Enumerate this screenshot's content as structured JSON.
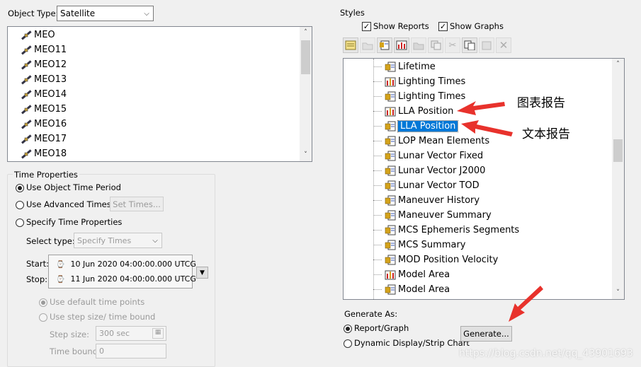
{
  "object_type": {
    "label": "Object Type:",
    "value": "Satellite"
  },
  "objects": [
    "MEO",
    "MEO11",
    "MEO12",
    "MEO13",
    "MEO14",
    "MEO15",
    "MEO16",
    "MEO17",
    "MEO18"
  ],
  "time_props": {
    "title": "Time Properties",
    "use_object": "Use Object Time Period",
    "use_advanced": "Use Advanced Times",
    "set_times": "Set Times...",
    "specify": "Specify Time Properties",
    "select_type_label": "Select type:",
    "select_type_value": "Specify Times",
    "start_label": "Start:",
    "start_value": "10 Jun 2020 04:00:00.000 UTCG",
    "stop_label": "Stop:",
    "stop_value": "11 Jun 2020 04:00:00.000 UTCG",
    "use_default": "Use default time points",
    "use_step": "Use step size/ time bound",
    "step_label": "Step size:",
    "step_value": "300 sec",
    "bound_label": "Time bound:",
    "bound_value": "0"
  },
  "styles": {
    "title": "Styles",
    "show_reports": "Show Reports",
    "show_graphs": "Show Graphs",
    "items": [
      {
        "label": "Lifetime",
        "kind": "report"
      },
      {
        "label": "Lighting Times",
        "kind": "graph"
      },
      {
        "label": "Lighting Times",
        "kind": "report"
      },
      {
        "label": "LLA Position",
        "kind": "graph"
      },
      {
        "label": "LLA Position",
        "kind": "report",
        "selected": true
      },
      {
        "label": "LOP Mean Elements",
        "kind": "report"
      },
      {
        "label": "Lunar Vector Fixed",
        "kind": "report"
      },
      {
        "label": "Lunar Vector J2000",
        "kind": "report"
      },
      {
        "label": "Lunar Vector TOD",
        "kind": "report"
      },
      {
        "label": "Maneuver History",
        "kind": "report"
      },
      {
        "label": "Maneuver Summary",
        "kind": "report"
      },
      {
        "label": "MCS Ephemeris Segments",
        "kind": "report"
      },
      {
        "label": "MCS Summary",
        "kind": "report"
      },
      {
        "label": "MOD Position Velocity",
        "kind": "report"
      },
      {
        "label": "Model Area",
        "kind": "graph"
      },
      {
        "label": "Model Area",
        "kind": "report"
      }
    ]
  },
  "generate": {
    "title": "Generate As:",
    "report_graph": "Report/Graph",
    "dynamic": "Dynamic Display/Strip Chart",
    "button": "Generate..."
  },
  "annotations": {
    "graph_report": "图表报告",
    "text_report": "文本报告",
    "arrow_color": "#e8322c"
  },
  "watermark": "https://blog.csdn.net/qq_43901693"
}
